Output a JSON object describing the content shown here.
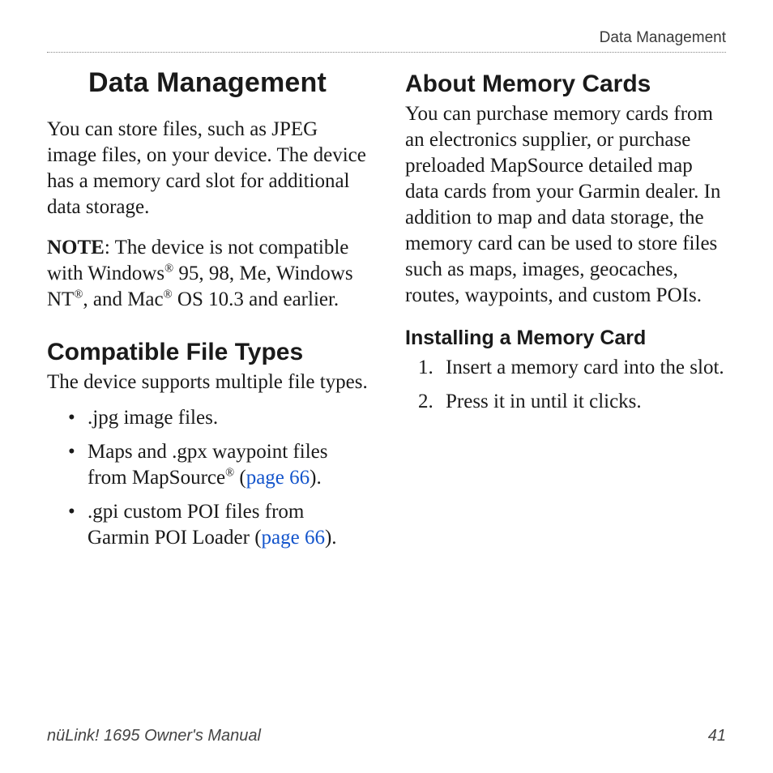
{
  "running_head": "Data Management",
  "left": {
    "chapter_title": "Data Management",
    "intro": "You can store files, such as JPEG image files, on your device. The device has a memory card slot for additional data storage.",
    "note_label": "NOTE",
    "note_before": ": The device is not compatible with Windows",
    "note_mid1": " 95, 98, Me, Windows NT",
    "note_mid2": ", and Mac",
    "note_after": " OS 10.3 and earlier.",
    "compat_title": "Compatible File Types",
    "compat_intro": "The device supports multiple file types.",
    "bullets": {
      "b1": ".jpg image files.",
      "b2_before": "Maps and .gpx waypoint files from MapSource",
      "b2_open": " (",
      "b2_link": "page 66",
      "b2_close": ").",
      "b3_before": ".gpi custom POI files from Garmin POI Loader (",
      "b3_link": "page 66",
      "b3_close": ")."
    }
  },
  "right": {
    "memory_title": "About Memory Cards",
    "memory_body": "You can purchase memory cards from an electronics supplier, or purchase preloaded MapSource detailed map data cards from your Garmin dealer. In addition to map and data storage, the memory card can be used to store files such as maps, images, geocaches, routes, waypoints, and custom POIs.",
    "install_title": "Installing a Memory Card",
    "steps": {
      "s1": "Insert a memory card into the slot.",
      "s2": "Press it in until it clicks."
    }
  },
  "footer": {
    "manual": "nüLink! 1695 Owner's Manual",
    "page": "41"
  },
  "reg": "®"
}
